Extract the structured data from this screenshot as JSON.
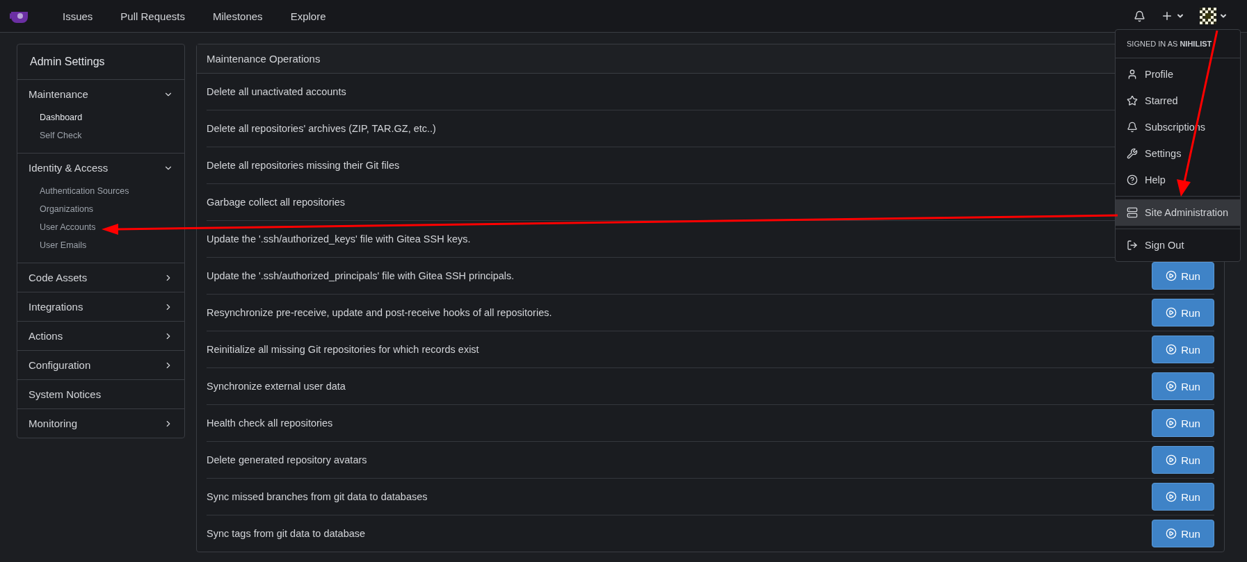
{
  "navbar": {
    "links": [
      "Issues",
      "Pull Requests",
      "Milestones",
      "Explore"
    ]
  },
  "sidebar": {
    "title": "Admin Settings",
    "sections": [
      {
        "label": "Maintenance",
        "expanded": true,
        "items": [
          {
            "label": "Dashboard",
            "selected": true
          },
          {
            "label": "Self Check",
            "selected": false
          }
        ]
      },
      {
        "label": "Identity & Access",
        "expanded": true,
        "items": [
          {
            "label": "Authentication Sources",
            "selected": false
          },
          {
            "label": "Organizations",
            "selected": false
          },
          {
            "label": "User Accounts",
            "selected": false
          },
          {
            "label": "User Emails",
            "selected": false
          }
        ]
      },
      {
        "label": "Code Assets",
        "expanded": false
      },
      {
        "label": "Integrations",
        "expanded": false
      },
      {
        "label": "Actions",
        "expanded": false
      },
      {
        "label": "Configuration",
        "expanded": false
      },
      {
        "label": "System Notices"
      },
      {
        "label": "Monitoring",
        "expanded": false
      }
    ]
  },
  "main": {
    "title": "Maintenance Operations",
    "rows": [
      {
        "label": "Delete all unactivated accounts"
      },
      {
        "label": "Delete all repositories' archives (ZIP, TAR.GZ, etc..)"
      },
      {
        "label": "Delete all repositories missing their Git files"
      },
      {
        "label": "Garbage collect all repositories"
      },
      {
        "label": "Update the '.ssh/authorized_keys' file with Gitea SSH keys."
      },
      {
        "label": "Update the '.ssh/authorized_principals' file with Gitea SSH principals.",
        "button": "Run"
      },
      {
        "label": "Resynchronize pre-receive, update and post-receive hooks of all repositories.",
        "button": "Run"
      },
      {
        "label": "Reinitialize all missing Git repositories for which records exist",
        "button": "Run"
      },
      {
        "label": "Synchronize external user data",
        "button": "Run"
      },
      {
        "label": "Health check all repositories",
        "button": "Run"
      },
      {
        "label": "Delete generated repository avatars",
        "button": "Run"
      },
      {
        "label": "Sync missed branches from git data to databases",
        "button": "Run"
      },
      {
        "label": "Sync tags from git data to database",
        "button": "Run"
      }
    ]
  },
  "user_menu": {
    "header": "SIGNED IN AS **NIHILIST**",
    "groups": [
      [
        {
          "label": "Profile",
          "selected": false
        },
        {
          "label": "Starred",
          "selected": false
        },
        {
          "label": "Subscriptions",
          "selected": false
        },
        {
          "label": "Settings",
          "selected": false
        },
        {
          "label": "Help",
          "selected": false
        }
      ],
      [
        {
          "label": "Site Administration",
          "selected": true
        }
      ],
      [
        {
          "label": "Sign Out",
          "selected": false
        }
      ]
    ]
  }
}
